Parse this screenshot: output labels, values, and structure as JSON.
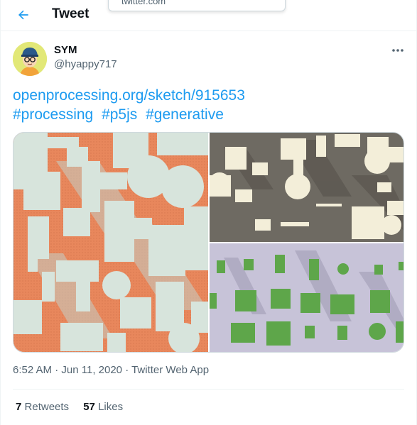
{
  "header": {
    "title": "Tweet",
    "url_popup_text": "twitter.com"
  },
  "author": {
    "name": "SYM",
    "handle": "@hyappy717"
  },
  "tweet": {
    "link": "openprocessing.org/sketch/915653",
    "hashtags": [
      "#processing",
      "#p5js",
      "#generative"
    ]
  },
  "meta": {
    "time": "6:52 AM",
    "separator1": " · ",
    "date": "Jun 11, 2020",
    "separator2": " · ",
    "source": "Twitter Web App"
  },
  "stats": {
    "retweets_count": "7",
    "retweets_label": "Retweets",
    "likes_count": "57",
    "likes_label": "Likes"
  },
  "colors": {
    "accent": "#1d9bf0",
    "orange_art_bg": "#e8875c",
    "mint_shapes": "#d7e4dc",
    "gray_art_bg": "#6e6a62",
    "cream_shapes": "#f3eed9",
    "lavender_art_bg": "#c7c3d8",
    "green_shapes": "#5ea64a"
  },
  "icons": {
    "back": "arrow-left-icon",
    "more": "more-horizontal-icon"
  }
}
